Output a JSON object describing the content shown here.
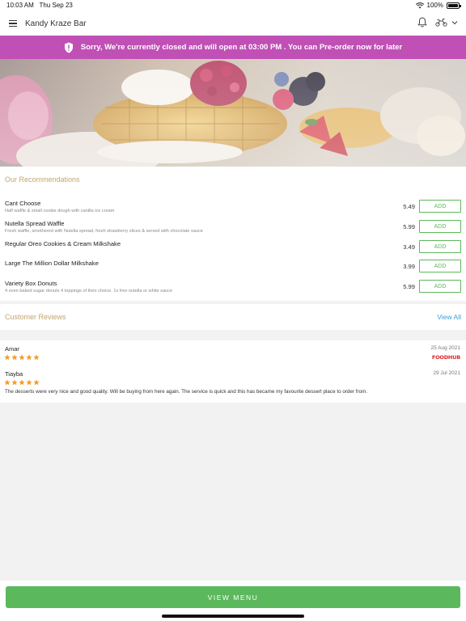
{
  "status_bar": {
    "time": "10:03 AM",
    "date": "Thu Sep 23",
    "battery": "100%"
  },
  "header": {
    "title": "Kandy Kraze Bar",
    "icons": [
      "hamburger-menu-icon",
      "bell-icon",
      "scooter-icon",
      "chevron-down-icon"
    ]
  },
  "banner": {
    "text": "Sorry, We're currently closed and will open at 03:00 PM . You can Pre-order now for later",
    "color": "#c050b5"
  },
  "recommendations": {
    "title": "Our Recommendations",
    "items": [
      {
        "name": "Cant Choose",
        "description": "Half waffle & small cookie dough with vanilla ice cream",
        "price": "5.49",
        "button": "ADD"
      },
      {
        "name": "Nutella Spread Waffle",
        "description": "Fresh waffle, smothered with Nutella spread, fresh strawberry slices & served with chocolate sauce",
        "price": "5.99",
        "button": "ADD"
      },
      {
        "name": "Regular Oreo Cookies & Cream Milkshake",
        "description": "",
        "price": "3.49",
        "button": "ADD"
      },
      {
        "name": "Large The Million Dollar Milkshake",
        "description": "",
        "price": "3.99",
        "button": "ADD"
      },
      {
        "name": "Variety Box Donuts",
        "description": "4 oven baked sugar donuts 4 toppings of their choice. 1x free nutella or white sauce",
        "price": "5.99",
        "button": "ADD"
      }
    ]
  },
  "reviews": {
    "title": "Customer Reviews",
    "view_all": "View All",
    "items": [
      {
        "author": "Amar",
        "date": "25 Aug 2021",
        "rating": 5,
        "source": "FOODHUB",
        "text": ""
      },
      {
        "author": "Tiayba",
        "date": "29 Jul 2021",
        "rating": 5,
        "source": "",
        "text": "The desserts were very nice and good quality. Will be buying from here again. The service is quick and this has became my favourite dessert place to order from."
      }
    ]
  },
  "bottom": {
    "button": "VIEW MENU"
  },
  "colors": {
    "accent_green": "#5cb85c",
    "banner_purple": "#c050b5",
    "section_gold": "#c3a56b",
    "link_blue": "#3a9fd8",
    "star_orange": "#f0a030"
  }
}
